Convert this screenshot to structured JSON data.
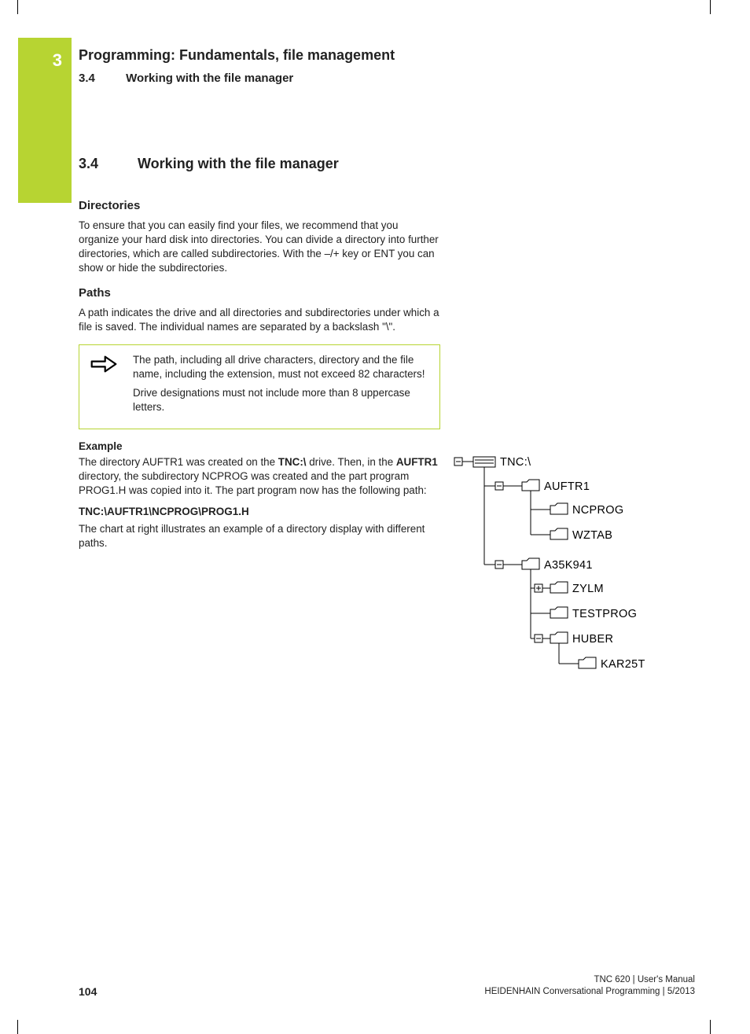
{
  "chapter_number": "3",
  "chapter_title": "Programming: Fundamentals, file management",
  "section_number": "3.4",
  "section_title": "Working with the file manager",
  "body": {
    "directories_head": "Directories",
    "directories_text": "To ensure that you can easily find your files, we recommend that you organize your hard disk into directories. You can divide a directory into further directories, which are called subdirectories. With the –/+ key or ENT you can show or hide the subdirectories.",
    "paths_head": "Paths",
    "paths_text": "A path indicates the drive and all directories and subdirectories under which a file is saved. The individual names are separated by a backslash \"\\\".",
    "note1": "The path, including all drive characters, directory and the file name, including the extension, must not exceed 82 characters!",
    "note2": "Drive designations must not include more than 8 uppercase letters.",
    "example_head": "Example",
    "example_p1a": "The directory AUFTR1 was created on the ",
    "example_p1b_bold": "TNC:\\",
    "example_p1c": " drive. Then, in the ",
    "example_p1d_bold": "AUFTR1",
    "example_p1e": " directory, the subdirectory NCPROG was created and the part program PROG1.H was copied into it. The part program now has the following path:",
    "example_path": "TNC:\\AUFTR1\\NCPROG\\PROG1.H",
    "example_p2": "The chart at right illustrates an example of a directory display with different paths."
  },
  "tree": {
    "root": "TNC:\\",
    "nodes": [
      {
        "label": "AUFTR1",
        "level": 1,
        "box": "minus"
      },
      {
        "label": "NCPROG",
        "level": 2,
        "box": ""
      },
      {
        "label": "WZTAB",
        "level": 2,
        "box": ""
      },
      {
        "label": "A35K941",
        "level": 1,
        "box": "minus"
      },
      {
        "label": "ZYLM",
        "level": 2,
        "box": "plus"
      },
      {
        "label": "TESTPROG",
        "level": 2,
        "box": ""
      },
      {
        "label": "HUBER",
        "level": 2,
        "box": "minus"
      },
      {
        "label": "KAR25T",
        "level": 3,
        "box": ""
      }
    ]
  },
  "footer": {
    "page": "104",
    "line1": "TNC 620 | User's Manual",
    "line2": "HEIDENHAIN Conversational Programming | 5/2013"
  }
}
